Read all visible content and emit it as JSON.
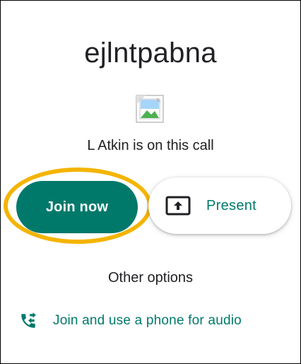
{
  "meeting": {
    "code": "ejlntpabna",
    "participants_text": "L Atkin is on this call"
  },
  "actions": {
    "join_label": "Join now",
    "present_label": "Present"
  },
  "other": {
    "heading": "Other options",
    "phone_audio_label": "Join and use a phone for audio"
  },
  "icons": {
    "avatar": "broken-image-icon",
    "present": "present-screen-icon",
    "phone": "phone-forwarded-icon"
  },
  "colors": {
    "accent": "#00796b",
    "highlight": "#f4b400",
    "text": "#202124"
  }
}
